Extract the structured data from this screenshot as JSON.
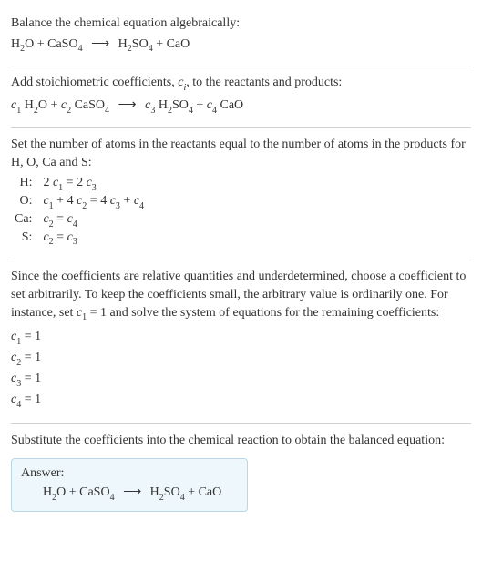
{
  "sec1": {
    "title": "Balance the chemical equation algebraically:",
    "eq": {
      "l1": "H",
      "l1s": "2",
      "l2": "O + CaSO",
      "l2s": "4",
      "r1": "H",
      "r1s": "2",
      "r2": "SO",
      "r2s": "4",
      "r3": " + CaO",
      "arrow": "⟶"
    }
  },
  "sec2": {
    "title_a": "Add stoichiometric coefficients, ",
    "title_ci": "c",
    "title_cis": "i",
    "title_b": ", to the reactants and products:",
    "eq": {
      "c1": "c",
      "c1s": "1",
      "sp1": " H",
      "sp1s": "2",
      "sp1b": "O + ",
      "c2": "c",
      "c2s": "2",
      "sp2": " CaSO",
      "sp2s": "4",
      "arrow": "⟶",
      "c3": "c",
      "c3s": "3",
      "sp3": " H",
      "sp3s": "2",
      "sp3b": "SO",
      "sp3bs": "4",
      "sp3c": " + ",
      "c4": "c",
      "c4s": "4",
      "sp4": " CaO"
    }
  },
  "sec3": {
    "title": "Set the number of atoms in the reactants equal to the number of atoms in the products for H, O, Ca and S:",
    "rows": [
      {
        "el": "H:",
        "lhs_a": "2 ",
        "lhs_c": "c",
        "lhs_s": "1",
        "mid": " = 2 ",
        "rhs_c": "c",
        "rhs_s": "3",
        "tail": ""
      },
      {
        "el": "O:",
        "lhs_a": "",
        "lhs_c": "c",
        "lhs_s": "1",
        "mid": " + 4 ",
        "rhs_c": "c",
        "rhs_s": "2",
        "tail_a": " = 4 ",
        "tail_c1": "c",
        "tail_s1": "3",
        "tail_b": " + ",
        "tail_c2": "c",
        "tail_s2": "4"
      },
      {
        "el": "Ca:",
        "lhs_a": "",
        "lhs_c": "c",
        "lhs_s": "2",
        "mid": " = ",
        "rhs_c": "c",
        "rhs_s": "4",
        "tail": ""
      },
      {
        "el": "S:",
        "lhs_a": "",
        "lhs_c": "c",
        "lhs_s": "2",
        "mid": " = ",
        "rhs_c": "c",
        "rhs_s": "3",
        "tail": ""
      }
    ]
  },
  "sec4": {
    "title_a": "Since the coefficients are relative quantities and underdetermined, choose a coefficient to set arbitrarily. To keep the coefficients small, the arbitrary value is ordinarily one. For instance, set ",
    "title_c": "c",
    "title_cs": "1",
    "title_b": " = 1 and solve the system of equations for the remaining coefficients:",
    "coeffs": [
      {
        "c": "c",
        "s": "1",
        "v": " = 1"
      },
      {
        "c": "c",
        "s": "2",
        "v": " = 1"
      },
      {
        "c": "c",
        "s": "3",
        "v": " = 1"
      },
      {
        "c": "c",
        "s": "4",
        "v": " = 1"
      }
    ]
  },
  "sec5": {
    "title": "Substitute the coefficients into the chemical reaction to obtain the balanced equation:",
    "answer_label": "Answer:",
    "eq": {
      "l1": "H",
      "l1s": "2",
      "l2": "O + CaSO",
      "l2s": "4",
      "arrow": "⟶",
      "r1": "H",
      "r1s": "2",
      "r2": "SO",
      "r2s": "4",
      "r3": " + CaO"
    }
  }
}
